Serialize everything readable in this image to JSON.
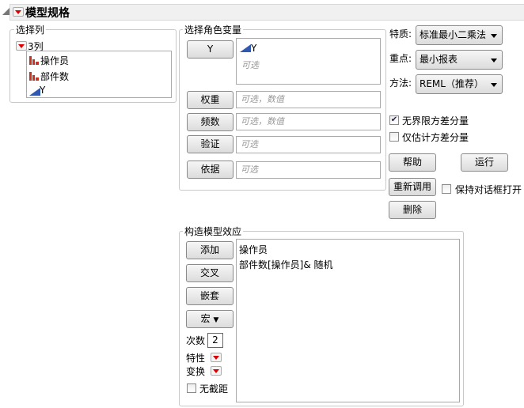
{
  "header": {
    "title": "模型规格"
  },
  "select_columns": {
    "label": "选择列",
    "count_label": "3列",
    "columns": [
      {
        "name": "操作员",
        "type": "nominal"
      },
      {
        "name": "部件数",
        "type": "nominal"
      },
      {
        "name": "Y",
        "type": "continuous"
      }
    ]
  },
  "roles": {
    "label": "选择角色变量",
    "y_button": "Y",
    "y_value": "Y",
    "y_optional": "可选",
    "rows": [
      {
        "button": "权重",
        "placeholder": "可选，数值"
      },
      {
        "button": "频数",
        "placeholder": "可选，数值"
      },
      {
        "button": "验证",
        "placeholder": "可选"
      },
      {
        "button": "依据",
        "placeholder": "可选"
      }
    ]
  },
  "options": {
    "personality_label": "特质:",
    "personality": "标准最小二乘法",
    "emphasis_label": "重点:",
    "emphasis": "最小报表",
    "method_label": "方法:",
    "method": "REML（推荐）",
    "unbounded_label": "无界限方差分量",
    "unbounded_checked": true,
    "estimate_only_label": "仅估计方差分量",
    "estimate_only_checked": false
  },
  "actions": {
    "help": "帮助",
    "run": "运行",
    "recall": "重新调用",
    "keep_open": "保持对话框打开",
    "keep_open_checked": false,
    "remove": "删除"
  },
  "effects": {
    "label": "构造模型效应",
    "add": "添加",
    "cross": "交叉",
    "nest": "嵌套",
    "macros": "宏",
    "degree_label": "次数",
    "degree": "2",
    "attributes_label": "特性",
    "transform_label": "变换",
    "no_intercept_label": "无截距",
    "no_intercept_checked": false,
    "items": [
      "操作员",
      "部件数[操作员]& 随机"
    ]
  }
}
